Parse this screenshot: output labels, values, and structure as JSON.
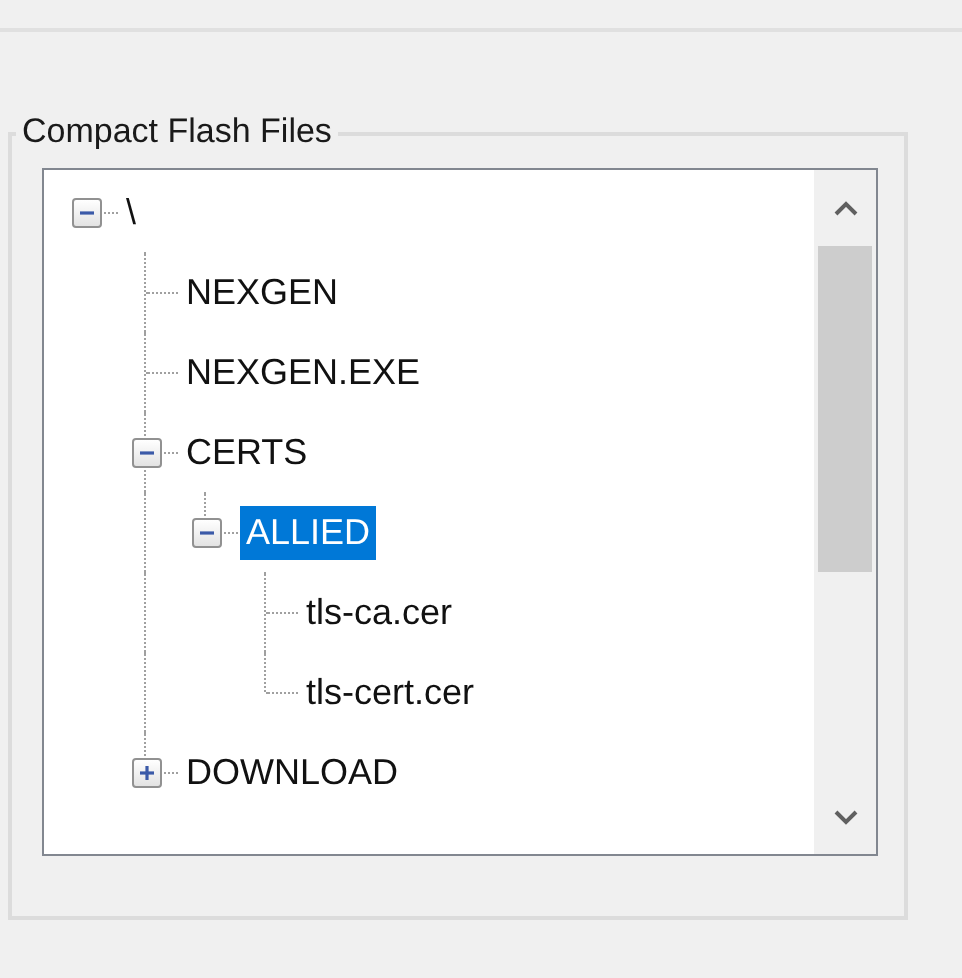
{
  "group": {
    "title": "Compact Flash Files"
  },
  "tree": [
    {
      "label": "\\",
      "expanded": true,
      "selected": false,
      "children": [
        {
          "label": "NEXGEN",
          "selected": false
        },
        {
          "label": "NEXGEN.EXE",
          "selected": false
        },
        {
          "label": "CERTS",
          "expanded": true,
          "selected": false,
          "children": [
            {
              "label": "ALLIED",
              "expanded": true,
              "selected": true,
              "children": [
                {
                  "label": "tls-ca.cer",
                  "selected": false
                },
                {
                  "label": "tls-cert.cer",
                  "selected": false
                }
              ]
            }
          ]
        },
        {
          "label": "DOWNLOAD",
          "expanded": false,
          "selected": false
        }
      ]
    }
  ]
}
